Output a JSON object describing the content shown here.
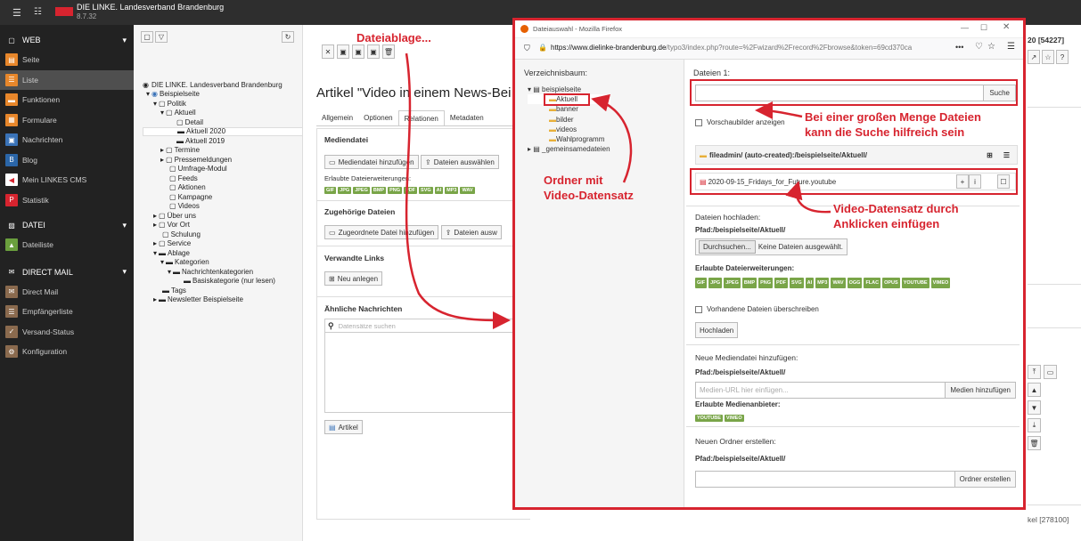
{
  "topbar": {
    "site_name": "DIE LINKE. Landesverband Brandenburg",
    "version": "8.7.32"
  },
  "leftnav": {
    "web_title": "WEB",
    "web_items": [
      "Seite",
      "Liste",
      "Funktionen",
      "Formulare",
      "Nachrichten",
      "Blog",
      "Mein LINKES CMS",
      "Statistik"
    ],
    "datei_title": "DATEI",
    "datei_items": [
      "Dateiliste"
    ],
    "mail_title": "DIRECT MAIL",
    "mail_items": [
      "Direct Mail",
      "Empfängerliste",
      "Versand-Status",
      "Konfiguration"
    ]
  },
  "tree": {
    "root": "DIE LINKE. Landesverband Brandenburg",
    "items": [
      "Beispielseite",
      "Politik",
      "Aktuell",
      "Detail",
      "Aktuell 2020",
      "Aktuell 2019",
      "Termine",
      "Pressemeldungen",
      "Umfrage-Modul",
      "Feeds",
      "Aktionen",
      "Kampagne",
      "Videos",
      "Über uns",
      "Vor Ort",
      "Schulung",
      "Service",
      "Ablage",
      "Kategorien",
      "Nachrichtenkategorien",
      "Basiskategorie (nur lesen)",
      "Tags",
      "Newsletter Beispielseite"
    ]
  },
  "main": {
    "title": "Artikel \"Video in einem News-Bei",
    "tabs": [
      "Allgemein",
      "Optionen",
      "Relationen",
      "Metadaten"
    ],
    "mediendatei_title": "Mediendatei",
    "mediendatei_add": "Mediendatei hinzufügen",
    "dateien_auswaehlen": "Dateien auswählen",
    "erlaubte": "Erlaubte Dateierweiterungen:",
    "badges": [
      "GIF",
      "JPG",
      "JPEG",
      "BMP",
      "PNG",
      "PDF",
      "SVG",
      "AI",
      "MP3",
      "WAV"
    ],
    "zugeh_title": "Zugehörige Dateien",
    "zugeh_add": "Zugeordnete Datei hinzufügen",
    "dateien_ausw2": "Dateien ausw",
    "links_title": "Verwandte Links",
    "neu_anlegen": "Neu anlegen",
    "aehnl_title": "Ähnliche Nachrichten",
    "search_placeholder": "Datensätze suchen",
    "artikel_btn": "Artikel",
    "right_id1": "20 [54227]",
    "right_id2": "kel [278100]"
  },
  "popup": {
    "window_title": "Dateiauswahl - Mozilla Firefox",
    "url_base": "https://www.dielinke-brandenburg.de",
    "url_rest": "/typo3/index.php?route=%2Fwizard%2Frecord%2Fbrowse&token=69cd370ca",
    "tree_title": "Verzeichnisbaum:",
    "tree_items": [
      "beispielseite",
      "Aktuell",
      "banner",
      "bilder",
      "videos",
      "Wahlprogramm",
      "_gemeinsamedateien"
    ],
    "files_title": "Dateien 1:",
    "suche": "Suche",
    "thumbs": "Vorschaubilder anzeigen",
    "path_header": "fileadmin/ (auto-created):/beispielseite/Aktuell/",
    "file_name": "2020-09-15_Fridays_for_Future.youtube",
    "upload_title": "Dateien hochladen:",
    "upload_path": "Pfad:/beispielseite/Aktuell/",
    "browse_btn": "Durchsuchen...",
    "no_files": "Keine Dateien ausgewählt.",
    "erlaubte": "Erlaubte Dateierweiterungen:",
    "badges": [
      "GIF",
      "JPG",
      "JPEG",
      "BMP",
      "PNG",
      "PDF",
      "SVG",
      "AI",
      "MP3",
      "WAV",
      "OGG",
      "FLAC",
      "OPUS",
      "YOUTUBE",
      "VIMEO"
    ],
    "overwrite": "Vorhandene Dateien überschreiben",
    "hochladen": "Hochladen",
    "media_title": "Neue Mediendatei hinzufügen:",
    "media_path": "Pfad:/beispielseite/Aktuell/",
    "media_placeholder": "Medien-URL hier einfügen...",
    "media_btn": "Medien hinzufügen",
    "anbieter": "Erlaubte Medienanbieter:",
    "anbieter_badges": [
      "YOUTUBE",
      "VIMEO"
    ],
    "folder_title": "Neuen Ordner erstellen:",
    "folder_path": "Pfad:/beispielseite/Aktuell/",
    "folder_btn": "Ordner erstellen"
  },
  "annotations": {
    "dateiablage": "Dateiablage...",
    "ordner1": "Ordner mit",
    "ordner2": "Video-Datensatz",
    "suche1": "Bei einer großen Menge Dateien",
    "suche2": "kann die Suche hilfreich sein",
    "video1": "Video-Datensatz durch",
    "video2": "Anklicken einfügen"
  },
  "colors": {
    "accent": "#d7242f",
    "badge": "#79a548",
    "nav_bg": "#222222"
  }
}
